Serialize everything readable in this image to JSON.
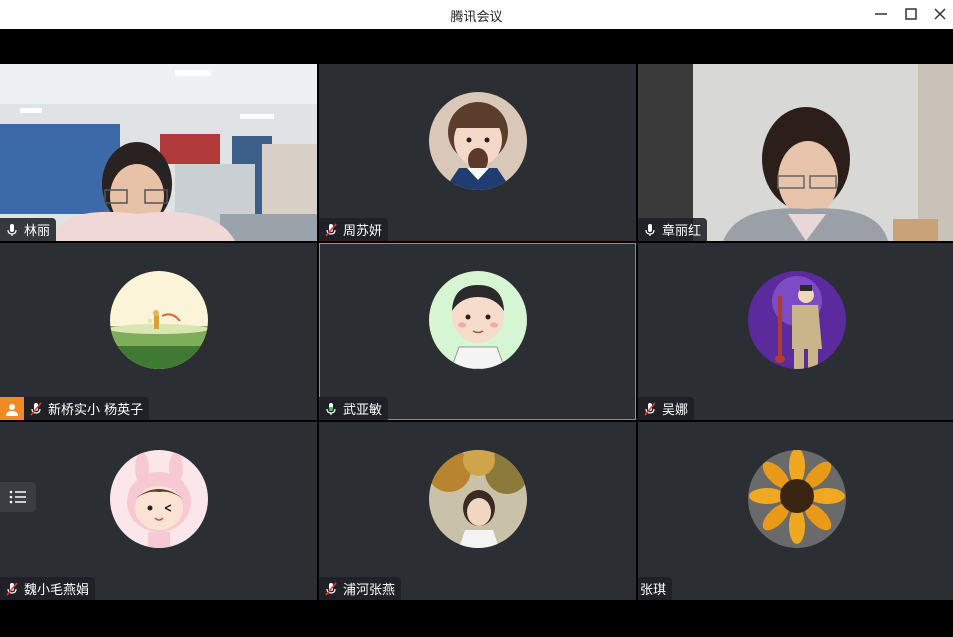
{
  "window": {
    "title": "腾讯会议",
    "controls": [
      "minimize-icon",
      "maximize-icon",
      "close-icon"
    ]
  },
  "participants": [
    {
      "name": "林丽",
      "video": true,
      "mic": "on"
    },
    {
      "name": "周苏妍",
      "video": false,
      "avatar": "girl-photo",
      "mic": "muted"
    },
    {
      "name": "章丽红",
      "video": true,
      "mic": "on"
    },
    {
      "name": "新桥实小 杨英子",
      "video": false,
      "avatar": "little-prince-art",
      "mic": "muted",
      "host": true
    },
    {
      "name": "武亚敏",
      "video": false,
      "avatar": "cartoon-boy",
      "mic": "speaking",
      "active": true
    },
    {
      "name": "吴娜",
      "video": false,
      "avatar": "boy-guitar-photo",
      "mic": "muted"
    },
    {
      "name": "魏小毛燕娟",
      "video": false,
      "avatar": "bunny-girl-cartoon",
      "mic": "muted"
    },
    {
      "name": "浦河张燕",
      "video": false,
      "avatar": "girl-tree-photo",
      "mic": "muted"
    },
    {
      "name": "张琪",
      "video": false,
      "avatar": "sunflower",
      "mic": "none"
    }
  ],
  "colors": {
    "tile_bg": "#2b2e33",
    "active_border": "#3fbf5e",
    "host_badge": "#f08a24",
    "mic_muted": "#e03c3c"
  },
  "side_button": {
    "icon": "participant-list-icon"
  }
}
